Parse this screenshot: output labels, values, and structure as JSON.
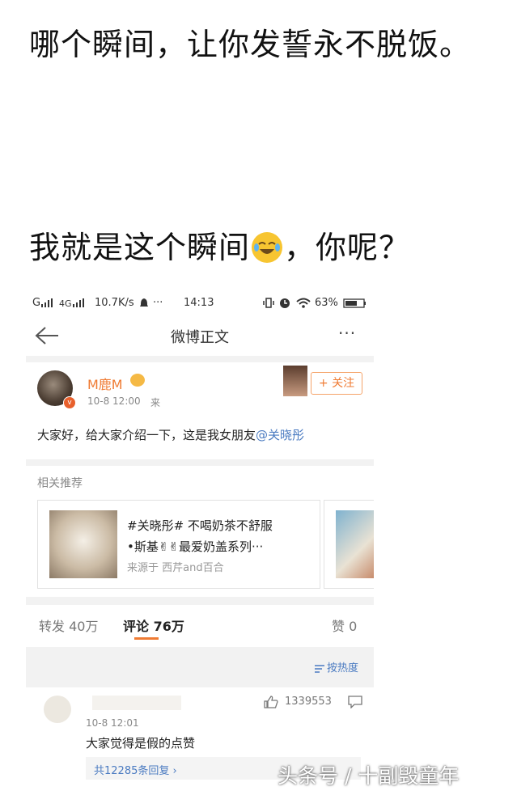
{
  "headline": {
    "line1": "哪个瞬间，让你发誓永不脱饭。",
    "line2_text": "我就是这个瞬间",
    "line2_tail": "，你呢？"
  },
  "status_bar": {
    "left": "G",
    "signal2": "4G",
    "speed": "10.7K/s",
    "dots": "···",
    "time": "14:13",
    "battery": "63%"
  },
  "nav": {
    "back_icon": "arrow-left-icon",
    "title": "微博正文",
    "more": "···"
  },
  "post": {
    "username": "M鹿M",
    "timestamp": "10-8 12:00",
    "source_suffix": "来",
    "follow_label": "+ 关注",
    "body_text": "大家好，给大家介绍一下，这是我女朋友",
    "mention": "@关晓彤"
  },
  "related": {
    "header": "相关推荐",
    "card": {
      "line1": "#关晓彤# 不喝奶茶不舒服",
      "line2": "•斯基✌✌最爱奶盖系列···",
      "source": "来源于 西芹and百合"
    }
  },
  "tabs": {
    "repost": "转发 40万",
    "comment": "评论 76万",
    "like": "赞 0"
  },
  "sort": {
    "label": "按热度",
    "icon": "sort-lines-icon"
  },
  "comment": {
    "timestamp": "10-8 12:01",
    "text": "大家觉得是假的点赞",
    "likes": "1339553",
    "replies": "共12285条回复 ›"
  },
  "watermark": "头条号 / 十副毁童年",
  "colors": {
    "orange": "#ef7b33",
    "link_blue": "#4b7bc1",
    "strip_gray": "#f2f2f2"
  }
}
